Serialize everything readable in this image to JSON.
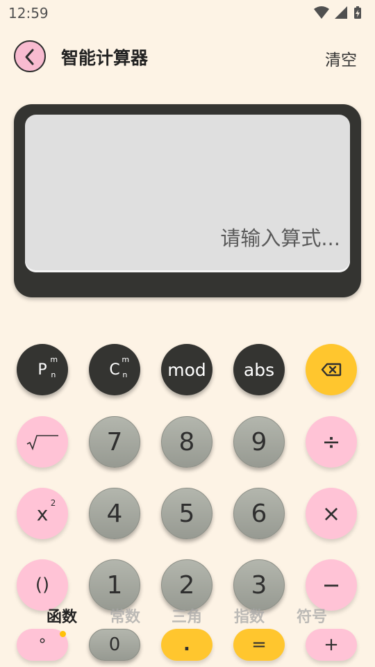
{
  "status_bar": {
    "time": "12:59",
    "icons": [
      "wifi-icon",
      "signal-icon",
      "battery-icon"
    ]
  },
  "header": {
    "title": "智能计算器",
    "clear_label": "清空"
  },
  "display": {
    "placeholder": "请输入算式..."
  },
  "keys": {
    "perm_main": "P",
    "perm_sup": "m",
    "perm_sub": "n",
    "comb_main": "C",
    "comb_sup": "m",
    "comb_sub": "n",
    "mod": "mod",
    "abs": "abs",
    "seven": "7",
    "eight": "8",
    "nine": "9",
    "divide": "÷",
    "square_base": "x",
    "square_exp": "2",
    "four": "4",
    "five": "5",
    "six": "6",
    "multiply": "×",
    "paren": "()",
    "one": "1",
    "two": "2",
    "three": "3",
    "minus": "−",
    "degree": "°",
    "zero": "0",
    "point": ".",
    "equals": "=",
    "plus": "+"
  },
  "tabs": [
    "函数",
    "常数",
    "三角",
    "指数",
    "符号"
  ],
  "active_tab_index": 0,
  "colors": {
    "background": "#FDF3E5",
    "dark_key": "#343431",
    "pink_key": "#FFC3D6",
    "yellow_key": "#FFC62E",
    "gray_key": "#A4A79F"
  }
}
